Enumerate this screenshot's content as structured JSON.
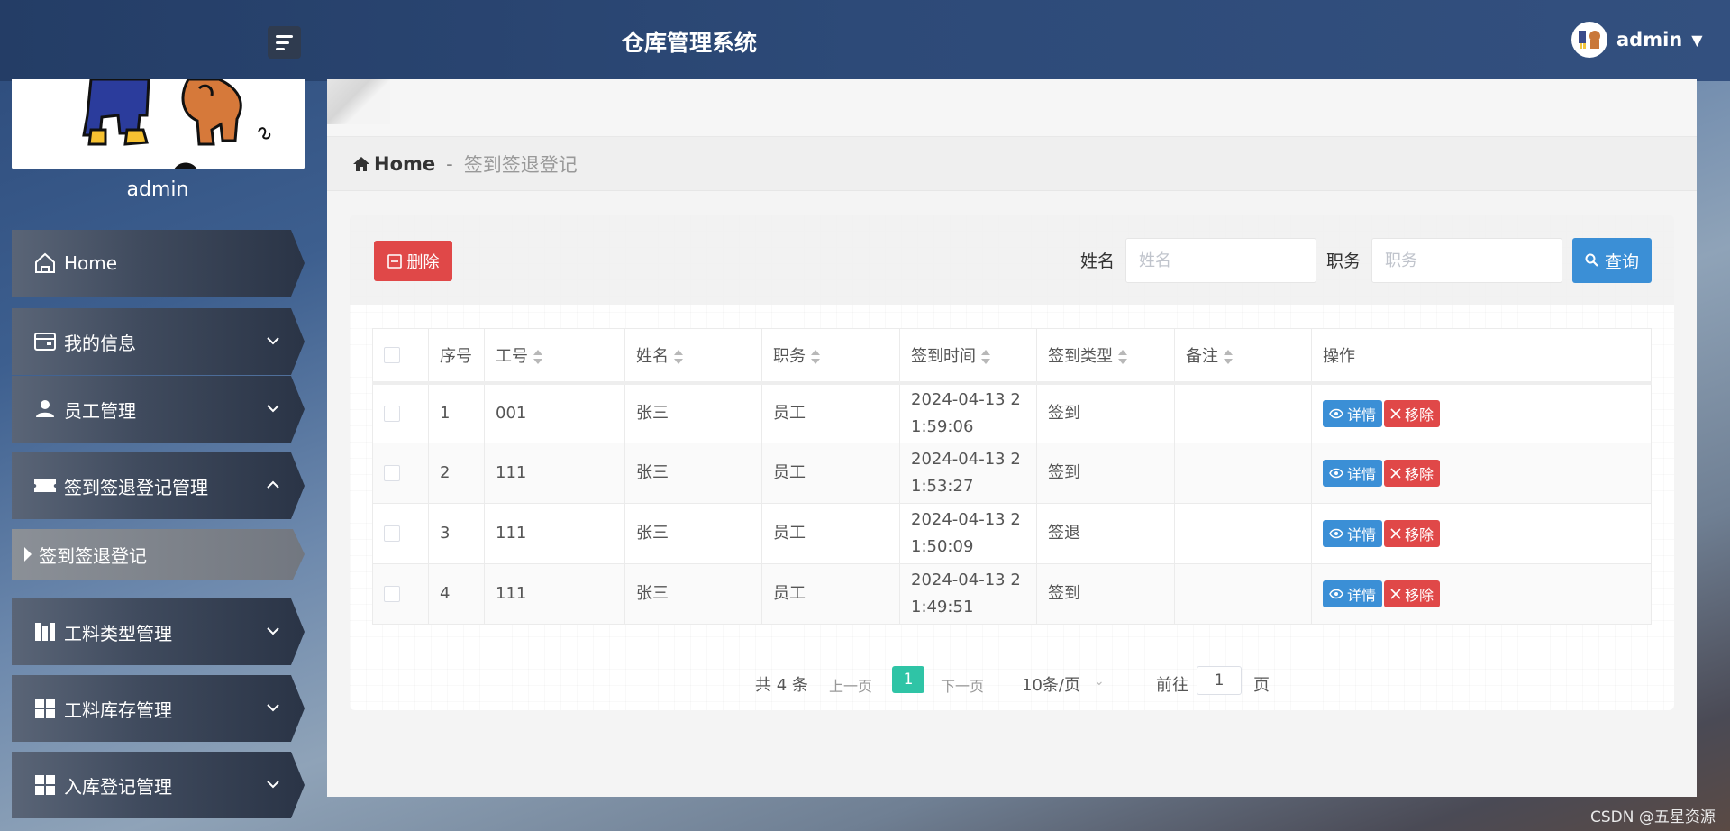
{
  "header": {
    "title": "仓库管理系统",
    "username": "admin"
  },
  "sidebar": {
    "username": "admin",
    "items": [
      {
        "label": "Home"
      },
      {
        "label": "我的信息"
      },
      {
        "label": "员工管理"
      },
      {
        "label": "签到签退登记管理"
      },
      {
        "label": "工料类型管理"
      },
      {
        "label": "工料库存管理"
      },
      {
        "label": "入库登记管理"
      }
    ],
    "sub_item": "签到签退登记"
  },
  "breadcrumb": {
    "home": "Home",
    "separator": "-",
    "current": "签到签退登记"
  },
  "toolbar": {
    "delete_label": "删除",
    "name_label": "姓名",
    "name_placeholder": "姓名",
    "role_label": "职务",
    "role_placeholder": "职务",
    "search_label": "查询"
  },
  "table": {
    "columns": [
      "序号",
      "工号",
      "姓名",
      "职务",
      "签到时间",
      "签到类型",
      "备注",
      "操作"
    ],
    "rows": [
      {
        "index": "1",
        "emp_id": "001",
        "name": "张三",
        "role": "员工",
        "time_line1": "2024-04-13 2",
        "time_line2": "1:59:06",
        "type": "签到",
        "note": ""
      },
      {
        "index": "2",
        "emp_id": "111",
        "name": "张三",
        "role": "员工",
        "time_line1": "2024-04-13 2",
        "time_line2": "1:53:27",
        "type": "签到",
        "note": ""
      },
      {
        "index": "3",
        "emp_id": "111",
        "name": "张三",
        "role": "员工",
        "time_line1": "2024-04-13 2",
        "time_line2": "1:50:09",
        "type": "签退",
        "note": ""
      },
      {
        "index": "4",
        "emp_id": "111",
        "name": "张三",
        "role": "员工",
        "time_line1": "2024-04-13 2",
        "time_line2": "1:49:51",
        "type": "签到",
        "note": ""
      }
    ],
    "detail_label": "详情",
    "remove_label": "移除"
  },
  "pagination": {
    "total": "共 4 条",
    "prev": "上一页",
    "current": "1",
    "next": "下一页",
    "page_size": "10条/页",
    "goto": "前往",
    "goto_value": "1",
    "page_suffix": "页"
  },
  "watermark": "CSDN @五星资源",
  "colors": {
    "danger": "#e04848",
    "primary": "#3b8fd6",
    "pager_active": "#2fc4a6"
  }
}
